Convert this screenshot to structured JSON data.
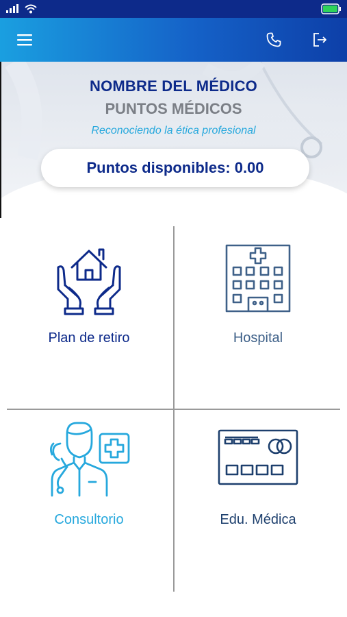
{
  "status_bar": {
    "signal_icon": "signal-bars-icon",
    "wifi_icon": "wifi-icon",
    "battery_icon": "battery-icon",
    "battery_color": "#2fd35a"
  },
  "app_bar": {
    "menu_icon": "hamburger-menu-icon",
    "phone_icon": "phone-icon",
    "logout_icon": "logout-icon",
    "gradient_colors": [
      "#1a9fe0",
      "#0d3fa8"
    ]
  },
  "header": {
    "doctor_name": "NOMBRE DEL MÉDICO",
    "program_title": "PUNTOS MÉDICOS",
    "tagline": "Reconociendo la ética profesional"
  },
  "points": {
    "label": "Puntos disponibles:",
    "value": "0.00"
  },
  "menu": [
    {
      "label": "Plan de retiro",
      "icon": "hands-house-icon",
      "color": "#0d2a8a"
    },
    {
      "label": "Hospital",
      "icon": "hospital-building-icon",
      "color": "#3e6088"
    },
    {
      "label": "Consultorio",
      "icon": "doctor-stethoscope-icon",
      "color": "#26a8dd"
    },
    {
      "label": "Edu. Médica",
      "icon": "credit-card-icon",
      "color": "#1d3f6d"
    }
  ]
}
